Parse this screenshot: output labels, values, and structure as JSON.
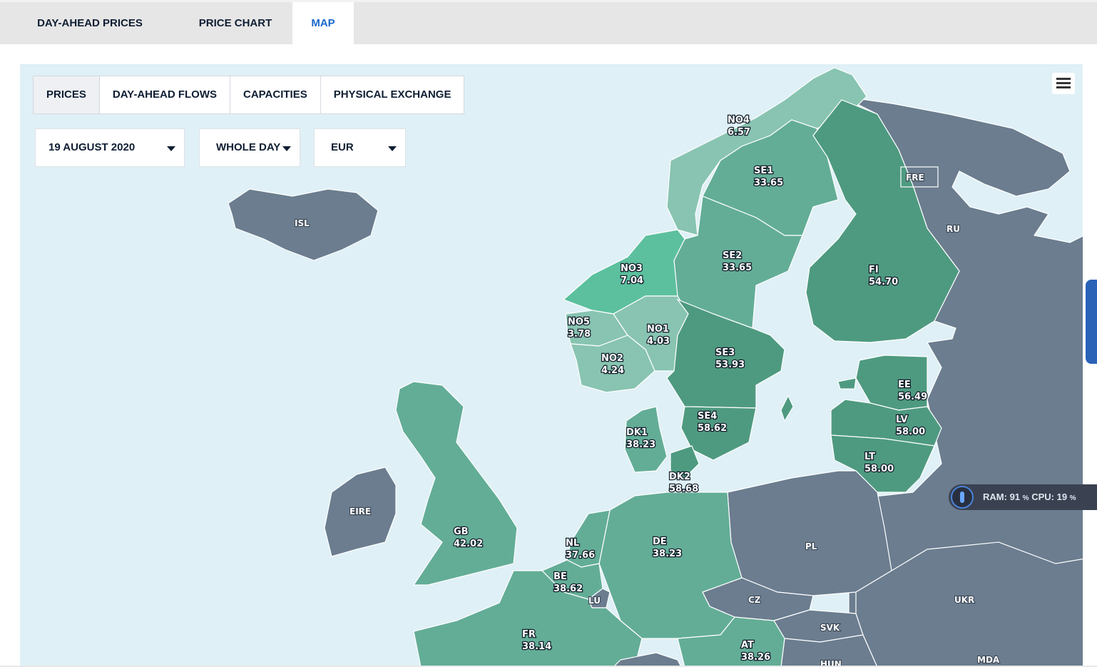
{
  "tabs": [
    {
      "label": "DAY-AHEAD PRICES",
      "active": false
    },
    {
      "label": "PRICE CHART",
      "active": false
    },
    {
      "label": "MAP",
      "active": true
    }
  ],
  "map_views": [
    {
      "label": "PRICES",
      "active": true
    },
    {
      "label": "DAY-AHEAD FLOWS",
      "active": false
    },
    {
      "label": "CAPACITIES",
      "active": false
    },
    {
      "label": "PHYSICAL EXCHANGE",
      "active": false
    }
  ],
  "filters": {
    "date": "19 AUGUST 2020",
    "period": "WHOLE DAY",
    "currency": "EUR"
  },
  "zones": [
    {
      "code": "NO4",
      "price": "6.57"
    },
    {
      "code": "SE1",
      "price": "33.65"
    },
    {
      "code": "SE2",
      "price": "33.65"
    },
    {
      "code": "FI",
      "price": "54.70"
    },
    {
      "code": "NO3",
      "price": "7.04"
    },
    {
      "code": "NO5",
      "price": "3.78"
    },
    {
      "code": "NO1",
      "price": "4.03"
    },
    {
      "code": "NO2",
      "price": "4.24"
    },
    {
      "code": "SE3",
      "price": "53.93"
    },
    {
      "code": "EE",
      "price": "56.49"
    },
    {
      "code": "SE4",
      "price": "58.62"
    },
    {
      "code": "DK1",
      "price": "38.23"
    },
    {
      "code": "LV",
      "price": "58.00"
    },
    {
      "code": "LT",
      "price": "58.00"
    },
    {
      "code": "DK2",
      "price": "58.68"
    },
    {
      "code": "GB",
      "price": "42.02"
    },
    {
      "code": "NL",
      "price": "37.66"
    },
    {
      "code": "DE",
      "price": "38.23"
    },
    {
      "code": "BE",
      "price": "38.62"
    },
    {
      "code": "FR",
      "price": "38.14"
    },
    {
      "code": "AT",
      "price": "38.26"
    }
  ],
  "countries": [
    "ISL",
    "FRE",
    "RU",
    "EIRE",
    "PL",
    "CZ",
    "UKR",
    "SVK",
    "LU",
    "MDA",
    "HUN"
  ],
  "colors": {
    "sea": "#dff0f6",
    "non_market": "#6b7d8f",
    "zone_low": "#88c4b1",
    "zone_mid": "#63ad97",
    "zone_high": "#4e9a80",
    "zone_teal": "#5cc09e",
    "active_tab": "#1a68c8"
  },
  "system_monitor": {
    "ram_label": "RAM:",
    "ram": "91",
    "cpu_label": "CPU:",
    "cpu": "19",
    "unit": "%"
  }
}
